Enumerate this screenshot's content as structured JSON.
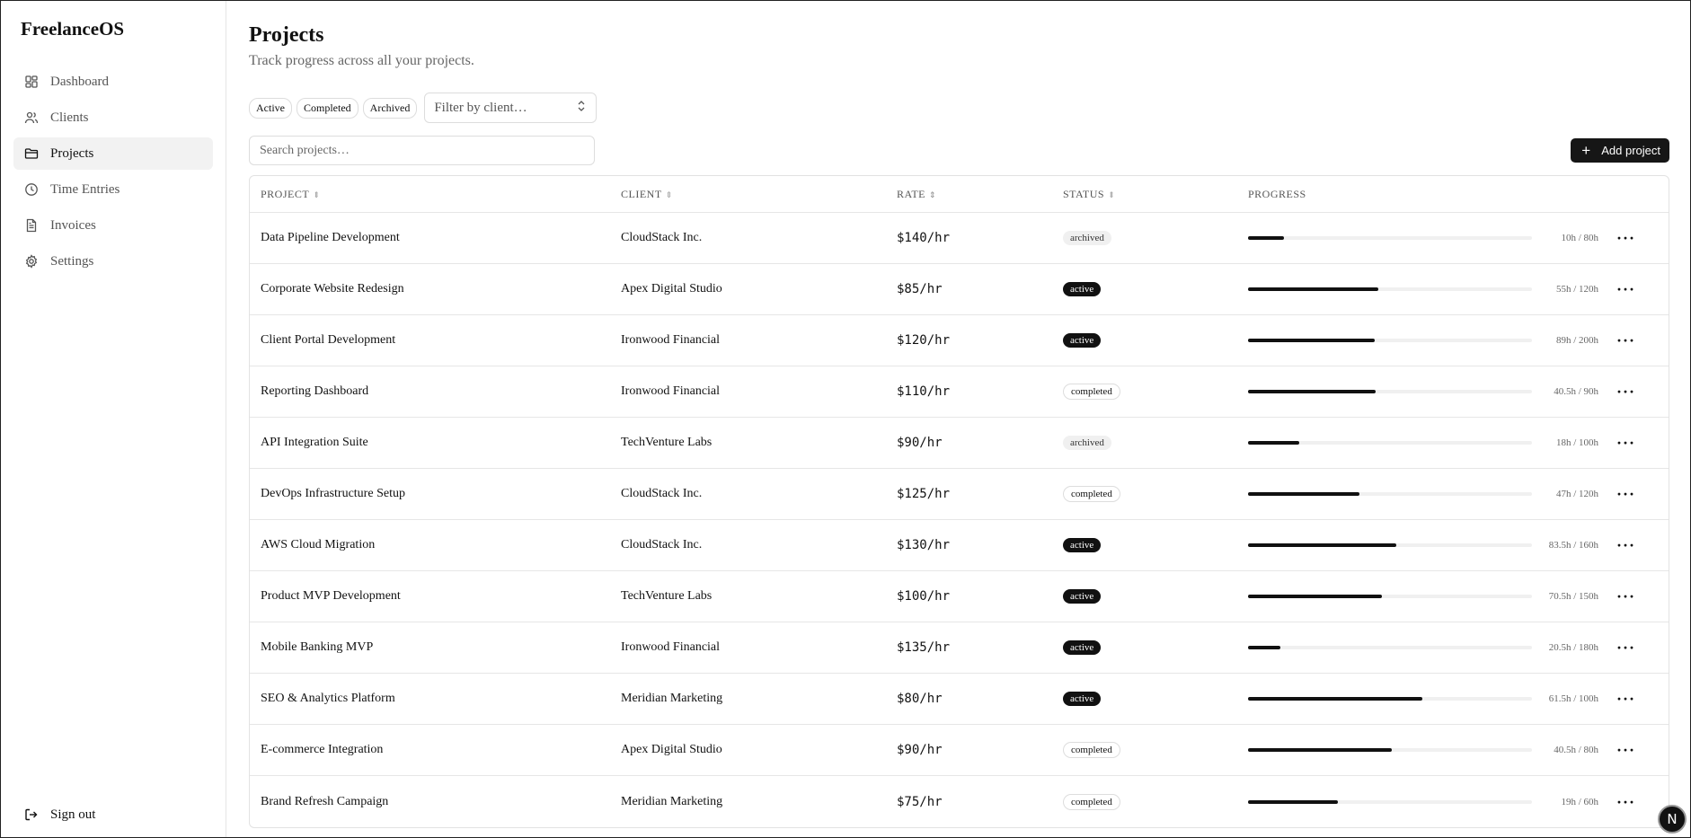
{
  "app": {
    "name": "FreelanceOS"
  },
  "sidebar": {
    "items": [
      {
        "label": "Dashboard",
        "icon": "dashboard-icon"
      },
      {
        "label": "Clients",
        "icon": "users-icon"
      },
      {
        "label": "Projects",
        "icon": "folder-icon",
        "active": true
      },
      {
        "label": "Time Entries",
        "icon": "clock-icon"
      },
      {
        "label": "Invoices",
        "icon": "file-icon"
      },
      {
        "label": "Settings",
        "icon": "gear-icon"
      }
    ],
    "signout": "Sign out"
  },
  "page": {
    "title": "Projects",
    "subtitle": "Track progress across all your projects."
  },
  "filters": {
    "chips": [
      "Active",
      "Completed",
      "Archived"
    ],
    "client_placeholder": "Filter by client…"
  },
  "search": {
    "placeholder": "Search projects…"
  },
  "add_button": "Add project",
  "table": {
    "headers": {
      "project": "PROJECT",
      "client": "CLIENT",
      "rate": "RATE",
      "status": "STATUS",
      "progress": "PROGRESS"
    },
    "rows": [
      {
        "project": "Data Pipeline Development",
        "client": "CloudStack Inc.",
        "rate": "$140/hr",
        "status": "archived",
        "hours": "10h / 80h",
        "progress": 0.125
      },
      {
        "project": "Corporate Website Redesign",
        "client": "Apex Digital Studio",
        "rate": "$85/hr",
        "status": "active",
        "hours": "55h / 120h",
        "progress": 0.458
      },
      {
        "project": "Client Portal Development",
        "client": "Ironwood Financial",
        "rate": "$120/hr",
        "status": "active",
        "hours": "89h / 200h",
        "progress": 0.445
      },
      {
        "project": "Reporting Dashboard",
        "client": "Ironwood Financial",
        "rate": "$110/hr",
        "status": "completed",
        "hours": "40.5h / 90h",
        "progress": 0.45
      },
      {
        "project": "API Integration Suite",
        "client": "TechVenture Labs",
        "rate": "$90/hr",
        "status": "archived",
        "hours": "18h / 100h",
        "progress": 0.18
      },
      {
        "project": "DevOps Infrastructure Setup",
        "client": "CloudStack Inc.",
        "rate": "$125/hr",
        "status": "completed",
        "hours": "47h / 120h",
        "progress": 0.392
      },
      {
        "project": "AWS Cloud Migration",
        "client": "CloudStack Inc.",
        "rate": "$130/hr",
        "status": "active",
        "hours": "83.5h / 160h",
        "progress": 0.522
      },
      {
        "project": "Product MVP Development",
        "client": "TechVenture Labs",
        "rate": "$100/hr",
        "status": "active",
        "hours": "70.5h / 150h",
        "progress": 0.47
      },
      {
        "project": "Mobile Banking MVP",
        "client": "Ironwood Financial",
        "rate": "$135/hr",
        "status": "active",
        "hours": "20.5h / 180h",
        "progress": 0.114
      },
      {
        "project": "SEO & Analytics Platform",
        "client": "Meridian Marketing",
        "rate": "$80/hr",
        "status": "active",
        "hours": "61.5h / 100h",
        "progress": 0.615
      },
      {
        "project": "E-commerce Integration",
        "client": "Apex Digital Studio",
        "rate": "$90/hr",
        "status": "completed",
        "hours": "40.5h / 80h",
        "progress": 0.506
      },
      {
        "project": "Brand Refresh Campaign",
        "client": "Meridian Marketing",
        "rate": "$75/hr",
        "status": "completed",
        "hours": "19h / 60h",
        "progress": 0.317
      }
    ]
  },
  "fab": {
    "label": "N"
  }
}
